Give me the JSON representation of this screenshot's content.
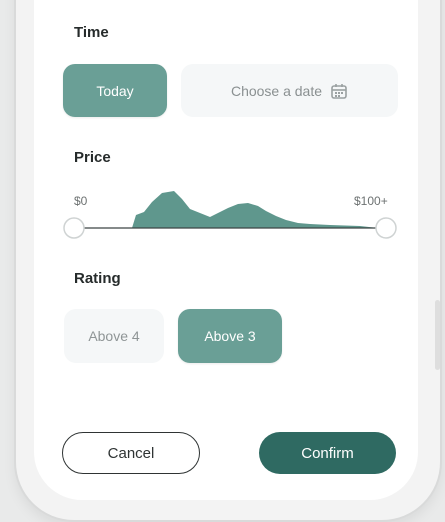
{
  "filter": {
    "time": {
      "label": "Time",
      "options": [
        {
          "label": "Today",
          "selected": true
        },
        {
          "label": "Choose a date",
          "selected": false,
          "icon": "calendar-icon"
        }
      ]
    },
    "price": {
      "label": "Price",
      "min_label": "$0",
      "max_label": "$100+",
      "range_selected": [
        0,
        100
      ]
    },
    "rating": {
      "label": "Rating",
      "options": [
        {
          "label": "Above 4",
          "selected": false
        },
        {
          "label": "Above 3",
          "selected": true
        }
      ]
    }
  },
  "actions": {
    "cancel_label": "Cancel",
    "confirm_label": "Confirm"
  },
  "colors": {
    "accent": "#6a9f96",
    "accent_dark": "#2f6a62",
    "inactive_bg": "#f5f7f8",
    "text_dark": "#262b2b"
  }
}
